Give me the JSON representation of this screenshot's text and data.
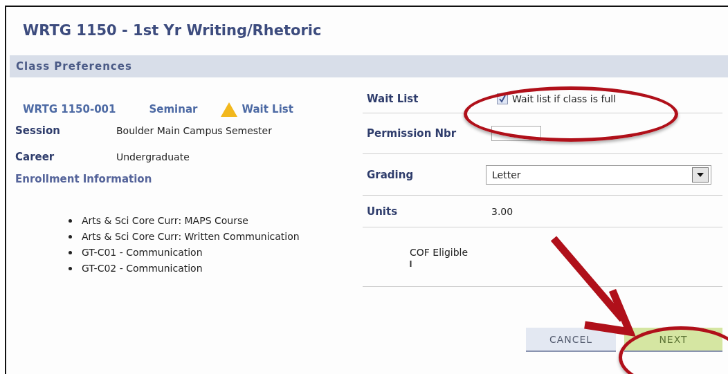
{
  "title": "WRTG 1150 - 1st Yr Writing/Rhetoric",
  "section_header": "Class Preferences",
  "class": {
    "number": "WRTG 1150-001",
    "component": "Seminar",
    "status": "Wait List"
  },
  "details": [
    {
      "label": "Session",
      "value": "Boulder Main Campus Semester"
    },
    {
      "label": "Career",
      "value": "Undergraduate"
    }
  ],
  "enrollment_info": {
    "label": "Enrollment Information",
    "items": [
      "Arts & Sci Core Curr: MAPS Course",
      "Arts & Sci Core Curr: Written Communication",
      "GT-C01 - Communication",
      "GT-C02 - Communication"
    ]
  },
  "wait_list": {
    "label": "Wait List",
    "option": "Wait list if class is full",
    "checked": true
  },
  "permission": {
    "label": "Permission Nbr"
  },
  "grading": {
    "label": "Grading",
    "value": "Letter"
  },
  "units": {
    "label": "Units",
    "value": "3.00"
  },
  "cof": {
    "label": "COF Eligible"
  },
  "buttons": [
    {
      "label": "CANCEL",
      "kind": "secondary"
    },
    {
      "label": "NEXT",
      "kind": "primary"
    }
  ]
}
